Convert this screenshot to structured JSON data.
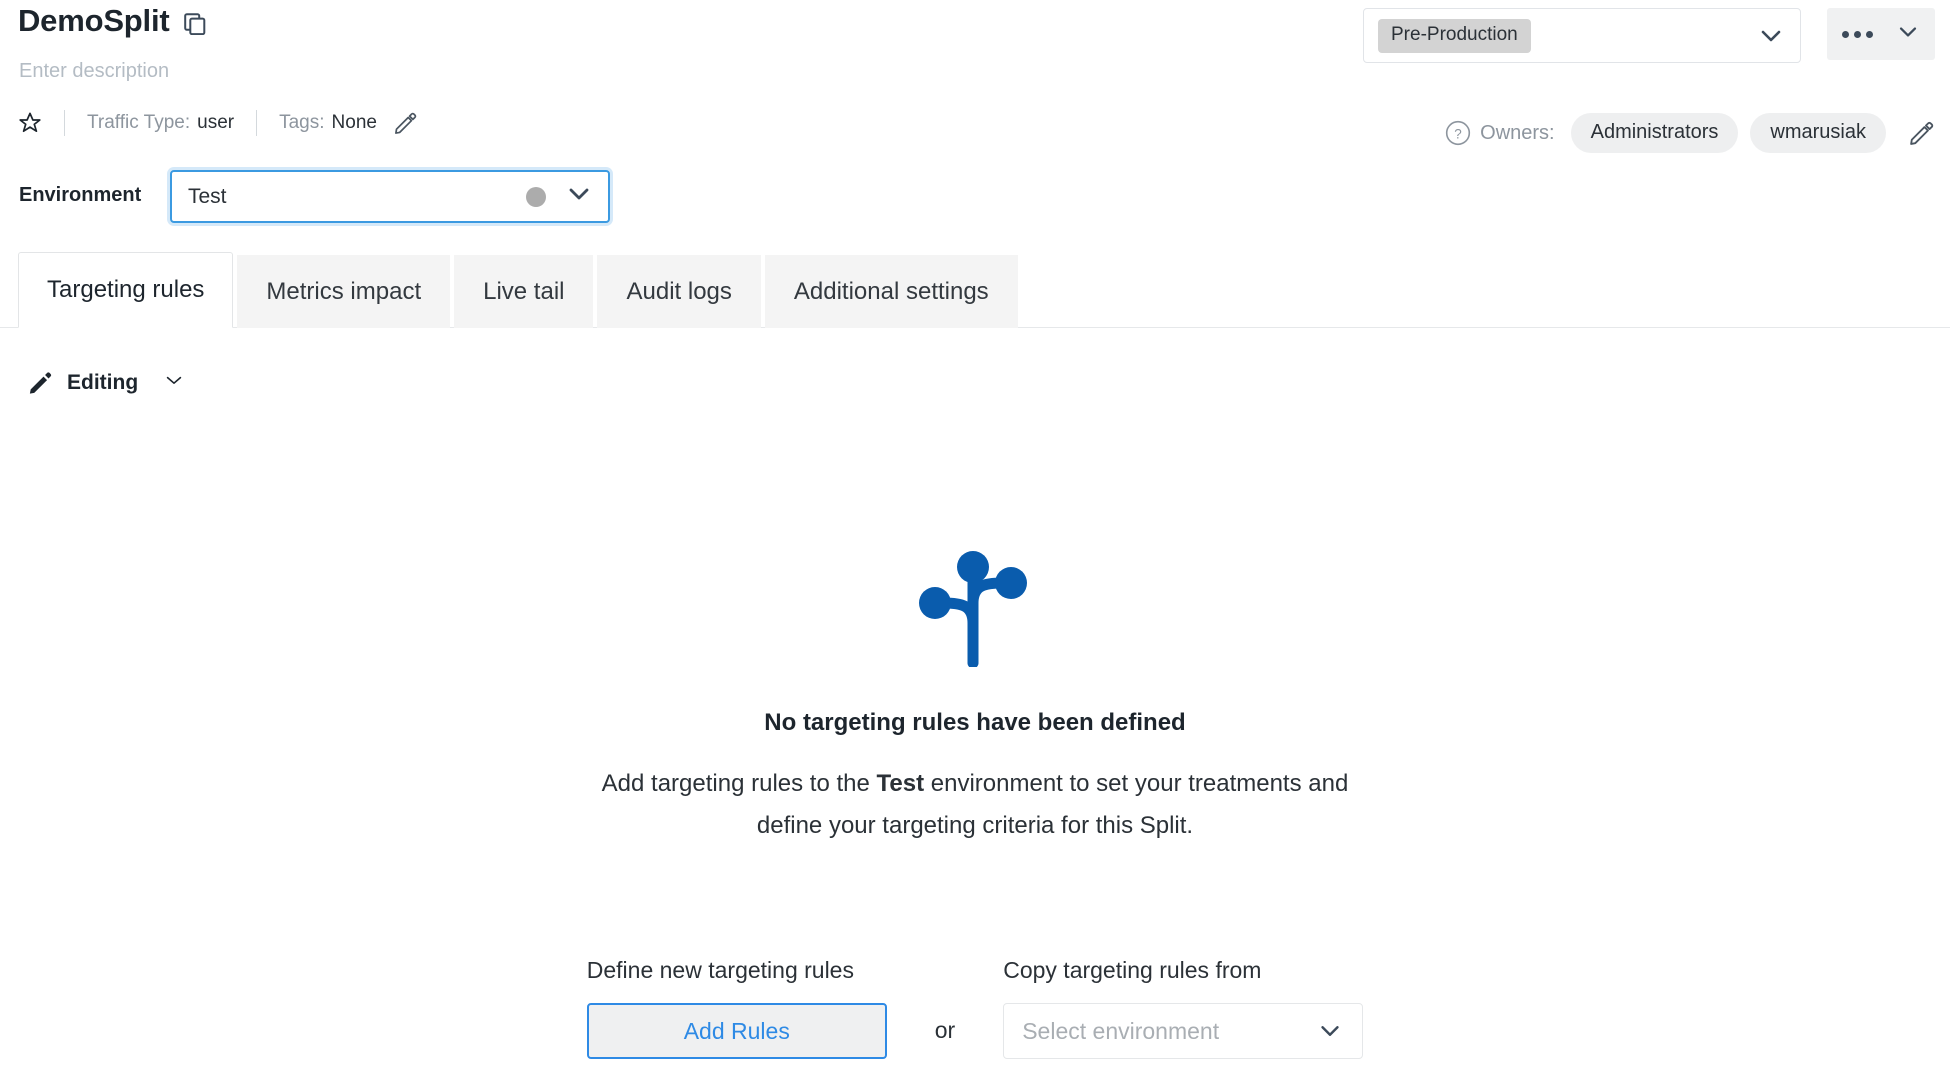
{
  "header": {
    "split_title": "DemoSplit",
    "copy_icon": "copy-icon",
    "description_placeholder": "Enter description",
    "star_icon": "star-outline-icon",
    "traffic_type_label": "Traffic Type:",
    "traffic_type_value": "user",
    "tags_label": "Tags:",
    "tags_value": "None",
    "edit_meta_icon": "pencil-icon"
  },
  "top_right": {
    "environment_group_value": "Pre-Production",
    "environment_group_chevron": "chevron-down-icon",
    "more_menu_dots": "ellipsis-icon",
    "more_menu_chevron": "chevron-down-icon"
  },
  "owners": {
    "help_icon": "question-circle-icon",
    "label": "Owners:",
    "chips": [
      "Administrators",
      "wmarusiak"
    ],
    "edit_icon": "pencil-icon"
  },
  "environment": {
    "label": "Environment",
    "value": "Test",
    "status_dot_color": "#acacac",
    "chevron": "chevron-down-icon"
  },
  "tabs": [
    {
      "label": "Targeting rules",
      "active": true
    },
    {
      "label": "Metrics impact",
      "active": false
    },
    {
      "label": "Live tail",
      "active": false
    },
    {
      "label": "Audit logs",
      "active": false
    },
    {
      "label": "Additional settings",
      "active": false
    }
  ],
  "toolbar": {
    "pencil_icon": "pencil-icon",
    "mode_label": "Editing",
    "mode_chevron": "chevron-down-icon"
  },
  "empty_state": {
    "graphic": "split-branch-icon",
    "title": "No targeting rules have been defined",
    "body_prefix": "Add targeting rules to the ",
    "body_env": "Test",
    "body_suffix": " environment to set your treatments and define your targeting criteria for this Split."
  },
  "actions": {
    "define_label": "Define new targeting rules",
    "add_rules_button": "Add Rules",
    "or_label": "or",
    "copy_label": "Copy targeting rules from",
    "select_environment_placeholder": "Select environment",
    "select_chevron": "chevron-down-icon"
  },
  "colors": {
    "accent_blue": "#2e8ae5",
    "brand_blue": "#0a5cad",
    "text_dark": "#1d252d",
    "text_muted": "#8d959e",
    "tab_inactive_bg": "#f4f4f4",
    "chip_bg": "#eeeff0"
  }
}
